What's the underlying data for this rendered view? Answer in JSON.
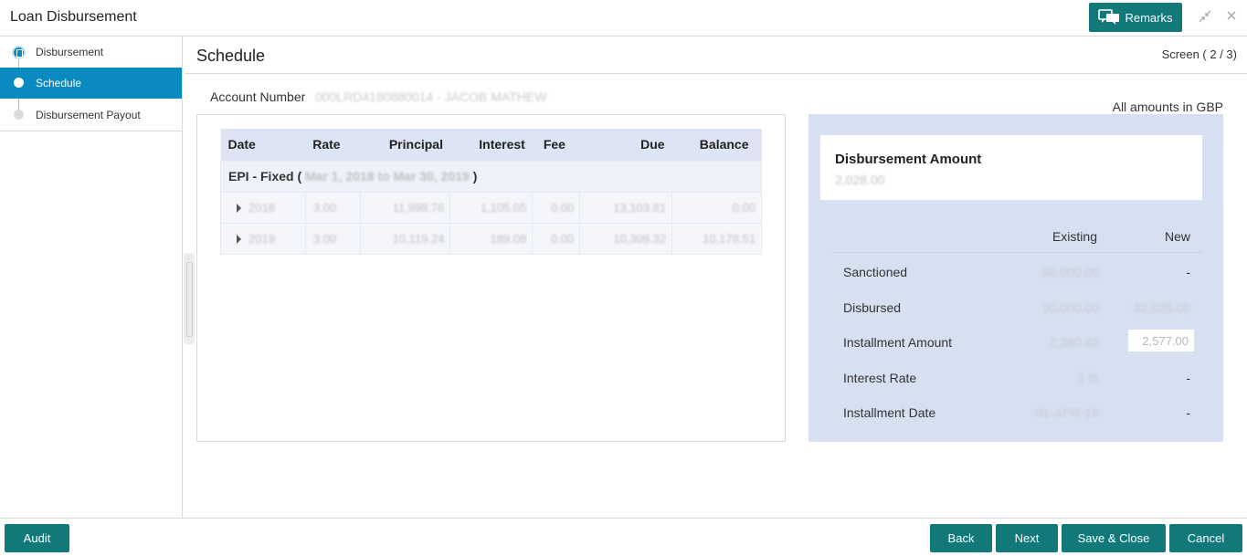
{
  "header": {
    "title": "Loan Disbursement",
    "remarks_label": "Remarks",
    "icons": [
      "chat-icon",
      "minimize-icon",
      "close-icon"
    ]
  },
  "sidebar": {
    "steps": [
      {
        "label": "Disbursement"
      },
      {
        "label": "Schedule"
      },
      {
        "label": "Disbursement Payout"
      }
    ]
  },
  "main": {
    "title": "Schedule",
    "screen_counter": "Screen ( 2 / 3)",
    "account_label": "Account Number",
    "account_value": "000LRD4180880014 - JACOB MATHEW",
    "amounts_note": "All amounts in GBP"
  },
  "schedule": {
    "columns": [
      "Date",
      "Rate",
      "Principal",
      "Interest",
      "Fee",
      "Due",
      "Balance"
    ],
    "group_label": "EPI - Fixed (",
    "group_period": "Mar 1, 2018 to Mar 30, 2019",
    "group_close": ")",
    "rows": [
      {
        "date": "2018",
        "rate": "3.00",
        "principal": "11,998.76",
        "interest": "1,105.05",
        "fee": "0.00",
        "due": "13,103.81",
        "balance": "0.00"
      },
      {
        "date": "2019",
        "rate": "3.00",
        "principal": "10,119.24",
        "interest": "189.08",
        "fee": "0.00",
        "due": "10,308.32",
        "balance": "10,178.51"
      }
    ]
  },
  "summary": {
    "disbursement_title": "Disbursement Amount",
    "disbursement_value": "2,028.00",
    "col_existing": "Existing",
    "col_new": "New",
    "rows": [
      {
        "label": "Sanctioned",
        "existing": "50,000.00",
        "new": "-"
      },
      {
        "label": "Disbursed",
        "existing": "30,000.00",
        "new": "32,028.00"
      },
      {
        "label": "Installment Amount",
        "existing": "2,360.83",
        "new": "2,577.00"
      },
      {
        "label": "Interest Rate",
        "existing": "3 %",
        "new": "-"
      },
      {
        "label": "Installment Date",
        "existing": "01-APR-18",
        "new": "-"
      }
    ]
  },
  "footer": {
    "audit": "Audit",
    "back": "Back",
    "next": "Next",
    "save_close": "Save & Close",
    "cancel": "Cancel"
  },
  "colors": {
    "accent_teal": "#12797a",
    "active_step": "#0a8bbf",
    "summary_bg": "#d7e0f1",
    "table_header": "#dde4f3"
  }
}
